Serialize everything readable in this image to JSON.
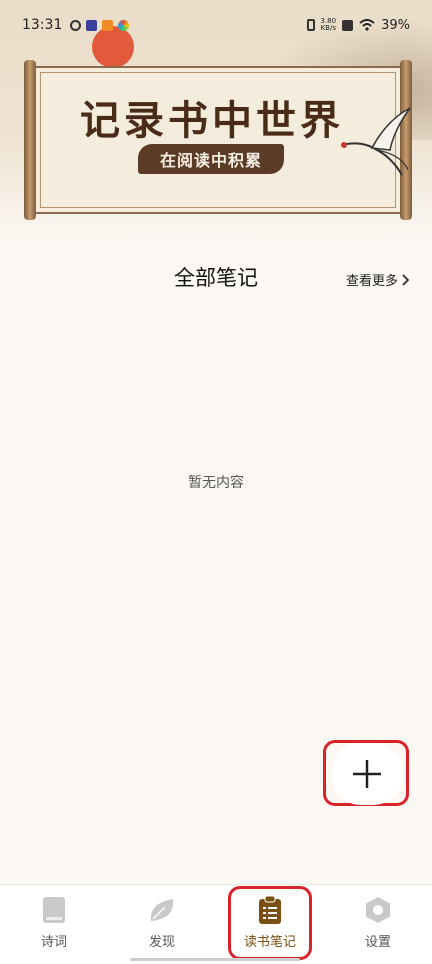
{
  "status_bar": {
    "time": "13:31",
    "net_speed_value": "3.80",
    "net_speed_unit": "KB/s",
    "battery": "39%"
  },
  "banner": {
    "title": "记录书中世界",
    "subtitle": "在阅读中积累"
  },
  "notes": {
    "section_title": "全部笔记",
    "more_label": "查看更多",
    "empty_text": "暂无内容"
  },
  "bottom_nav": {
    "items": [
      {
        "label": "诗词",
        "icon": "book-icon"
      },
      {
        "label": "发现",
        "icon": "leaf-icon"
      },
      {
        "label": "读书笔记",
        "icon": "clipboard-icon",
        "active": true
      },
      {
        "label": "设置",
        "icon": "hexagon-settings-icon"
      }
    ]
  },
  "colors": {
    "active": "#7a4f12",
    "inactive_icon": "#c9c9c9",
    "highlight": "#d8232a"
  }
}
